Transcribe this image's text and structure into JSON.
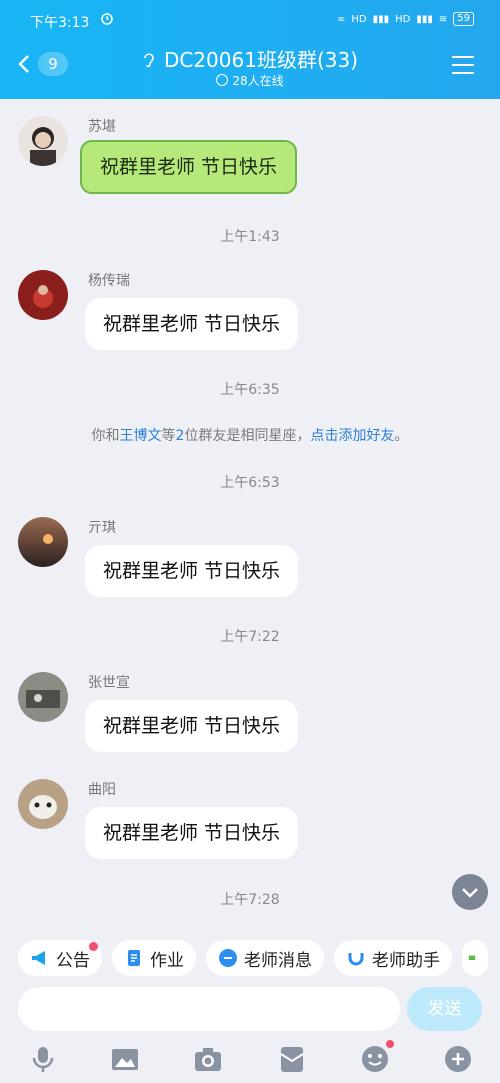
{
  "status_bar": {
    "time": "下午3:13",
    "hd1": "HD",
    "hd2": "HD",
    "battery": "59"
  },
  "header": {
    "unread_count": "9",
    "title": "DC20061班级群(33)",
    "online": "28人在线"
  },
  "messages": [
    {
      "sender": "苏堪",
      "text": "祝群里老师 节日快乐",
      "sticker": true
    },
    {
      "timestamp": "上午1:43"
    },
    {
      "sender": "杨传瑞",
      "text": "祝群里老师 节日快乐"
    },
    {
      "timestamp": "上午6:35"
    },
    {
      "system": {
        "prefix": "你和",
        "name": "王博文",
        "mid": "等",
        "count": "2",
        "suffix": "位群友是相同星座，",
        "action": "点击添加好友",
        "end": "。"
      }
    },
    {
      "timestamp": "上午6:53"
    },
    {
      "sender": "亓琪",
      "text": "祝群里老师 节日快乐"
    },
    {
      "timestamp": "上午7:22"
    },
    {
      "sender": "张世宣",
      "text": "祝群里老师 节日快乐"
    },
    {
      "sender": "曲阳",
      "text": "祝群里老师 节日快乐"
    },
    {
      "timestamp": "上午7:28"
    }
  ],
  "quick_chips": [
    {
      "label": "公告",
      "icon": "megaphone-icon",
      "badge": true
    },
    {
      "label": "作业",
      "icon": "document-icon"
    },
    {
      "label": "老师消息",
      "icon": "teacher-message-icon"
    },
    {
      "label": "老师助手",
      "icon": "teacher-assistant-icon"
    }
  ],
  "composer": {
    "send_label": "发送"
  },
  "toolbar": [
    "microphone-icon",
    "image-icon",
    "camera-icon",
    "red-packet-icon",
    "emoji-icon",
    "plus-icon"
  ],
  "colors": {
    "header": "#1fb0f3",
    "accent": "#2c80d6",
    "sticker": "#b7e87a",
    "badge": "#f0506e"
  }
}
